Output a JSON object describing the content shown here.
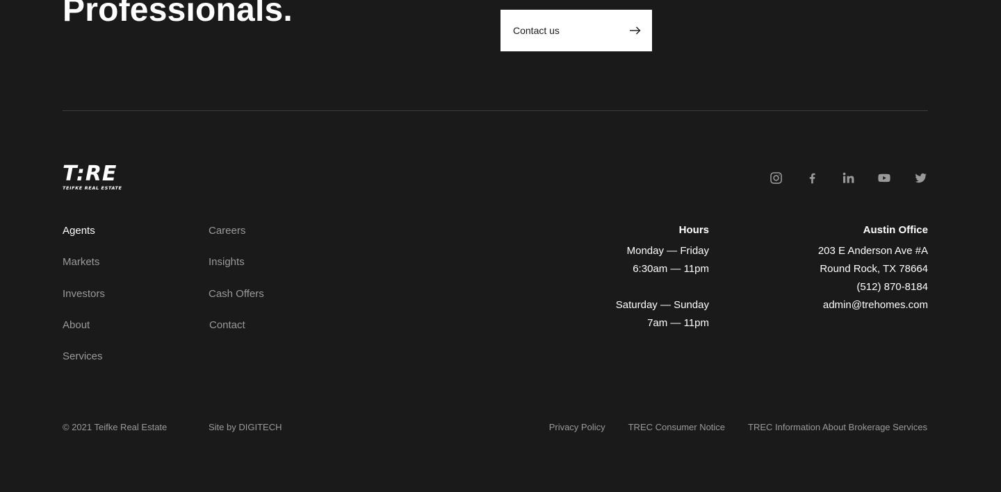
{
  "hero": {
    "title": "Professionals.",
    "contact_label": "Contact us"
  },
  "logo": {
    "mark": "T:RE",
    "name": "TEIFKE REAL ESTATE"
  },
  "social": [
    "instagram-icon",
    "facebook-icon",
    "linkedin-icon",
    "youtube-icon",
    "twitter-icon"
  ],
  "nav": {
    "column1": [
      "Agents",
      "Markets",
      "Investors",
      "About",
      "Services"
    ],
    "column2": [
      "Careers",
      "Insights",
      "Cash Offers",
      "Contact"
    ]
  },
  "hours": {
    "title": "Hours",
    "weekday_days": "Monday — Friday",
    "weekday_time": "6:30am — 11pm",
    "weekend_days": "Saturday — Sunday",
    "weekend_time": "7am — 11pm"
  },
  "office": {
    "title": "Austin Office",
    "address1": "203 E Anderson Ave #A",
    "address2": "Round Rock, TX 78664",
    "phone": "(512) 870-8184",
    "email": "admin@trehomes.com"
  },
  "footer": {
    "copyright": "© 2021 Teifke Real Estate",
    "site_by": "Site by DIGITECH",
    "links": [
      "Privacy Policy",
      "TREC Consumer Notice",
      "TREC Information About Brokerage Services"
    ]
  },
  "colors": {
    "background": "#1a1a1a",
    "text": "#ffffff",
    "muted": "#9a9a9a",
    "divider": "#3e3e3e"
  }
}
